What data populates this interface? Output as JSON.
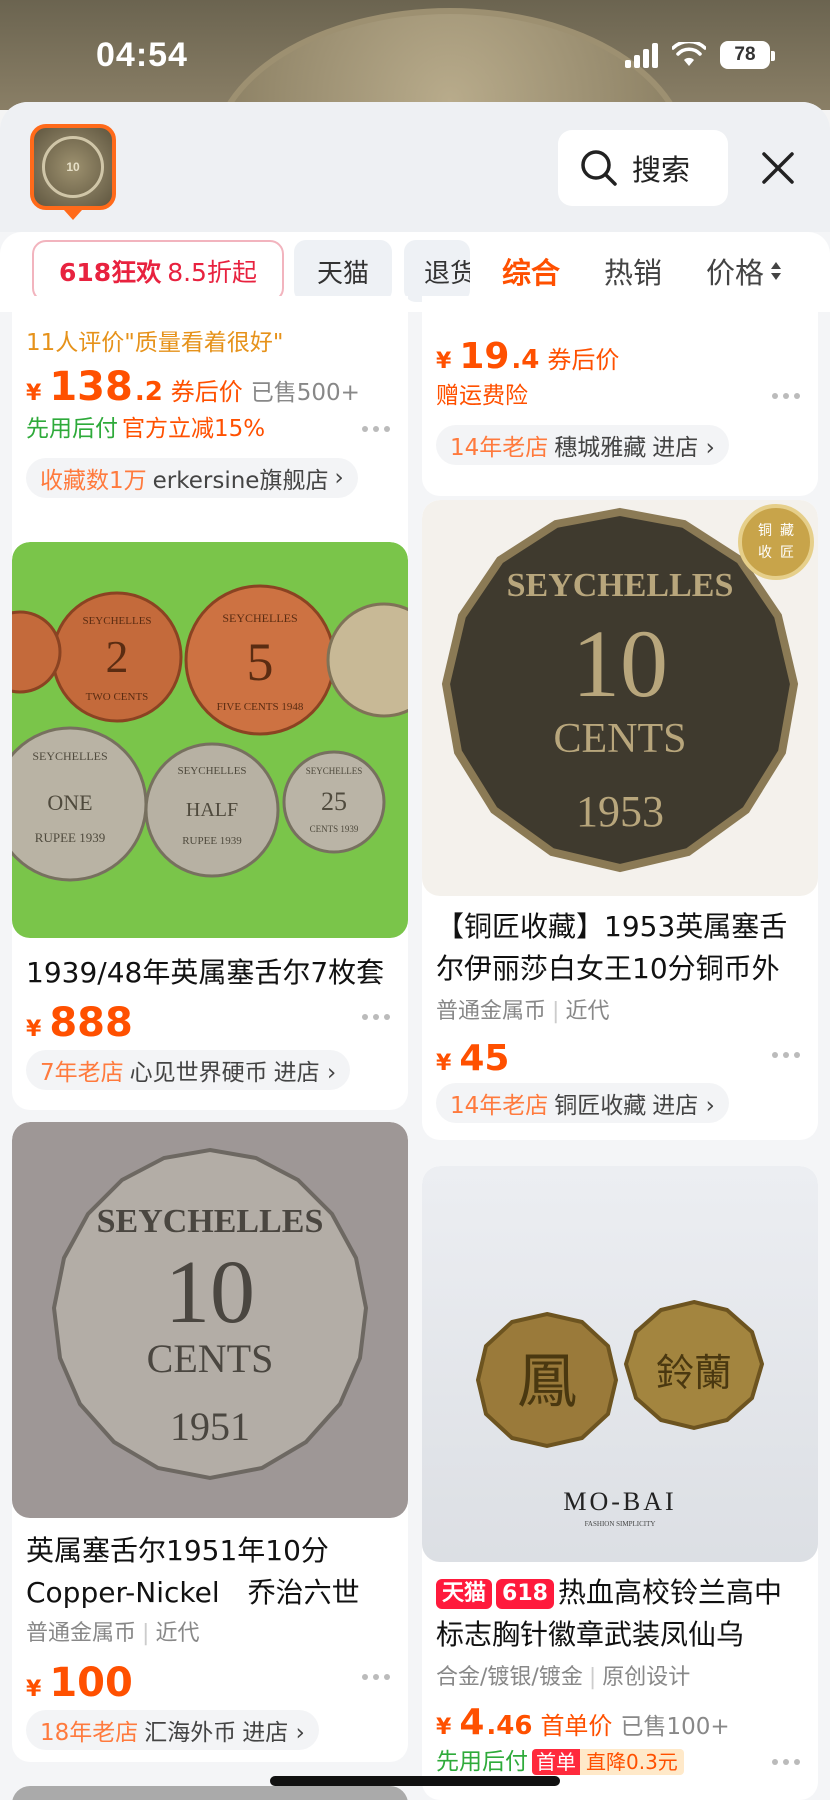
{
  "status": {
    "time": "04:54",
    "battery": "78"
  },
  "header": {
    "search_label": "搜索"
  },
  "filters": {
    "promo_main": "618狂欢",
    "promo_sub": "8.5折起",
    "chips": [
      "天猫",
      "退货"
    ],
    "sorts": [
      "综合",
      "热销",
      "价格"
    ]
  },
  "left": {
    "card0": {
      "review": "11人评价\"质量看着很好\"",
      "price": "138",
      "price_dec": ".2",
      "price_tag": "券后价",
      "sold": "已售500+",
      "benefit1": "先用后付",
      "benefit2": "官方立减15%",
      "shop_age": "收藏数1万",
      "shop_name": "erkersine旗舰店",
      "shop_arrow": "›"
    },
    "card1": {
      "title": "1939/48年英属塞舌尔7枚套",
      "price": "888",
      "shop_age": "7年老店",
      "shop_name": "心见世界硬币",
      "shop_enter": "进店 ›",
      "coins": [
        {
          "top": "SEYCHELLES",
          "mid": "2",
          "bot": "TWO CENTS"
        },
        {
          "top": "SEYCHELLES",
          "mid": "5",
          "bot": "FIVE CENTS 1948"
        },
        {
          "top": "SEYCHELLES",
          "mid": "ONE",
          "bot": "RUPEE 1939"
        },
        {
          "top": "SEYCHELLES",
          "mid": "HALF",
          "bot": "RUPEE 1939"
        },
        {
          "top": "SEYCHELLES",
          "mid": "25",
          "bot": "CENTS 1939"
        }
      ]
    },
    "card2": {
      "coin_top": "SEYCHELLES",
      "coin_mid": "10",
      "coin_unit": "CENTS",
      "coin_year": "1951",
      "title": "英属塞舌尔1951年10分 Copper-Nickel　乔治六世",
      "attr1": "普通金属币",
      "attr2": "近代",
      "price": "100",
      "shop_age": "18年老店",
      "shop_name": "汇海外币",
      "shop_enter": "进店 ›"
    }
  },
  "right": {
    "card0": {
      "price": "19",
      "price_dec": ".4",
      "price_tag": "券后价",
      "benefit": "赠运费险",
      "shop_age": "14年老店",
      "shop_name": "穗城雅藏",
      "shop_enter": "进店 ›"
    },
    "card1": {
      "seal": [
        "铜",
        "收",
        "藏",
        "匠"
      ],
      "coin_top": "SEYCHELLES",
      "coin_mid": "10",
      "coin_unit": "CENTS",
      "coin_year": "1953",
      "title": "【铜匠收藏】1953英属塞舌尔伊丽莎白女王10分铜币外",
      "attr1": "普通金属币",
      "attr2": "近代",
      "price": "45",
      "shop_age": "14年老店",
      "shop_name": "铜匠收藏",
      "shop_enter": "进店 ›"
    },
    "card2": {
      "brand": "MO-BAI",
      "brand_sub": "FASHION SIMPLICITY",
      "pin1": "鳳",
      "pin2": "鈴蘭",
      "badge_tm": "天猫",
      "badge_618": "618",
      "title": "热血高校铃兰高中标志胸针徽章武装凤仙乌",
      "attr1": "合金/镀银/镀金",
      "attr2": "原创设计",
      "price": "4",
      "price_dec": ".46",
      "price_tag": "首单价",
      "sold": "已售100+",
      "benefit": "先用后付",
      "promo1": "首单",
      "promo2": "直降0.3元"
    }
  }
}
